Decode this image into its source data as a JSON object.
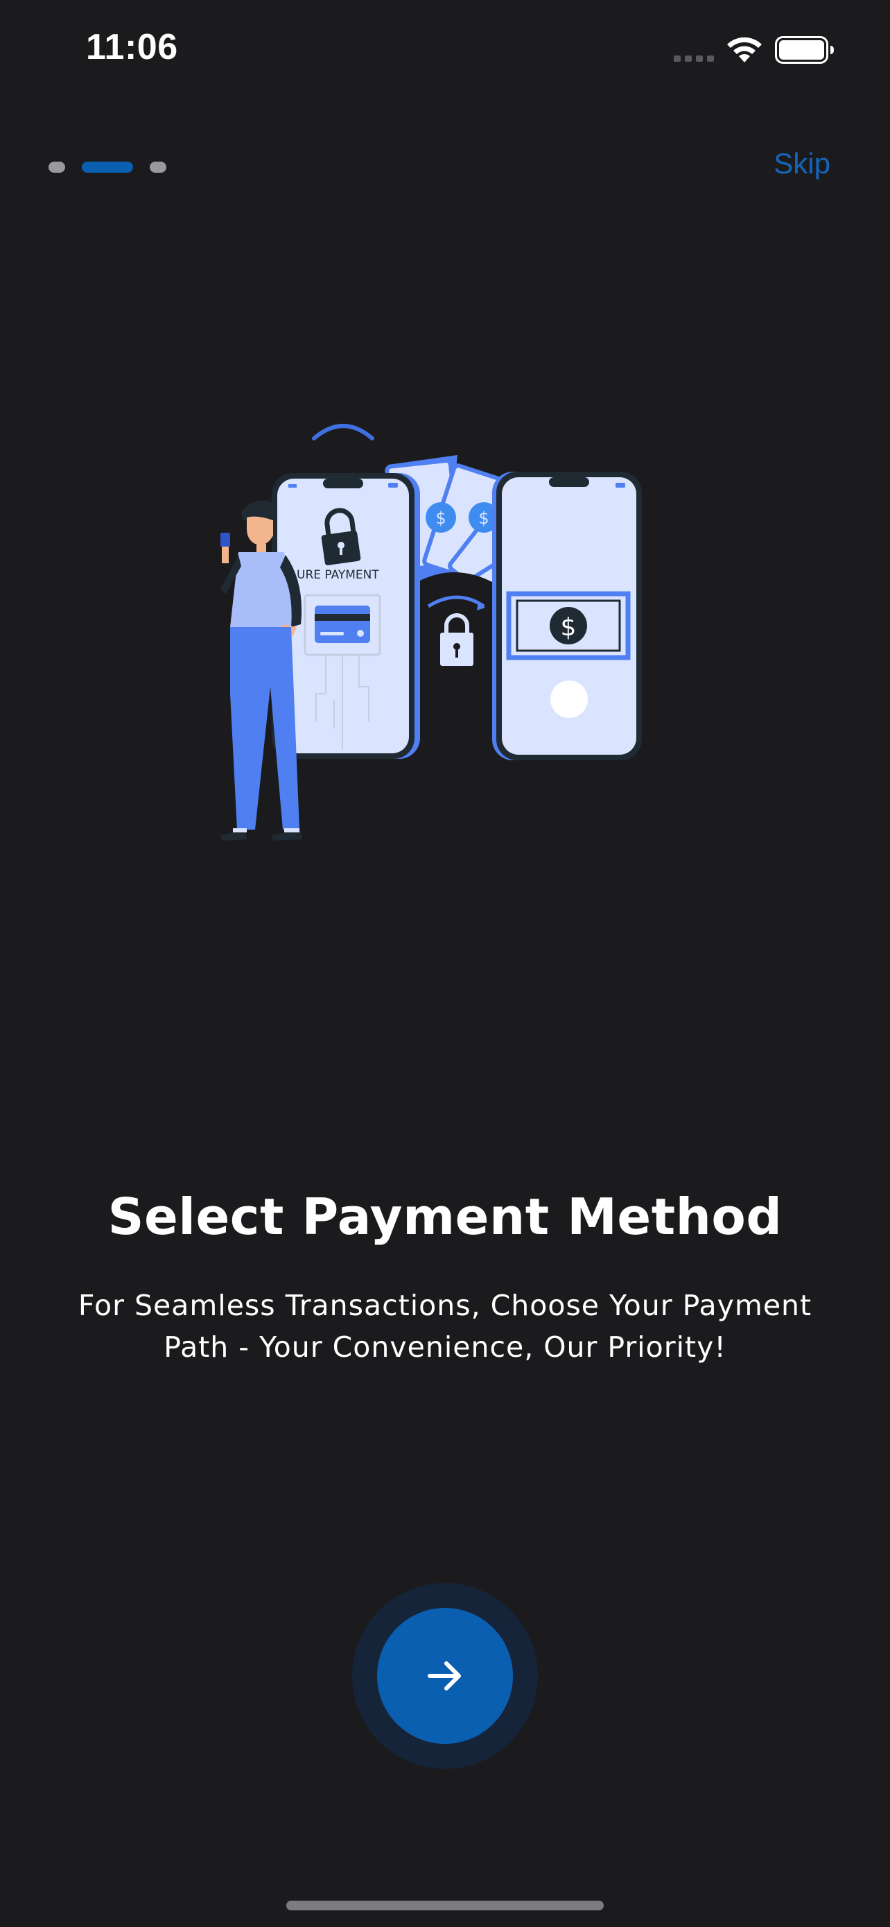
{
  "status_bar": {
    "time": "11:06",
    "signal_icon": "cellular-signal-icon",
    "wifi_icon": "wifi-icon",
    "battery_icon": "battery-full-icon"
  },
  "onboarding": {
    "page_count": 3,
    "active_page": 2,
    "skip_label": "Skip",
    "illustration_caption": "URE PAYMENT",
    "illustration_currency_symbol": "$",
    "title": "Select Payment Method",
    "subtitle": "For Seamless Transactions, Choose Your Payment Path - Your Convenience, Our Priority!",
    "next_icon": "arrow-right-icon"
  },
  "colors": {
    "background": "#1b1b1d",
    "accent": "#0b5fb0",
    "accent_text": "#1565b8",
    "halo": "#16243a",
    "illustration_primary": "#4f7ff0",
    "illustration_light": "#dbe4ff"
  }
}
